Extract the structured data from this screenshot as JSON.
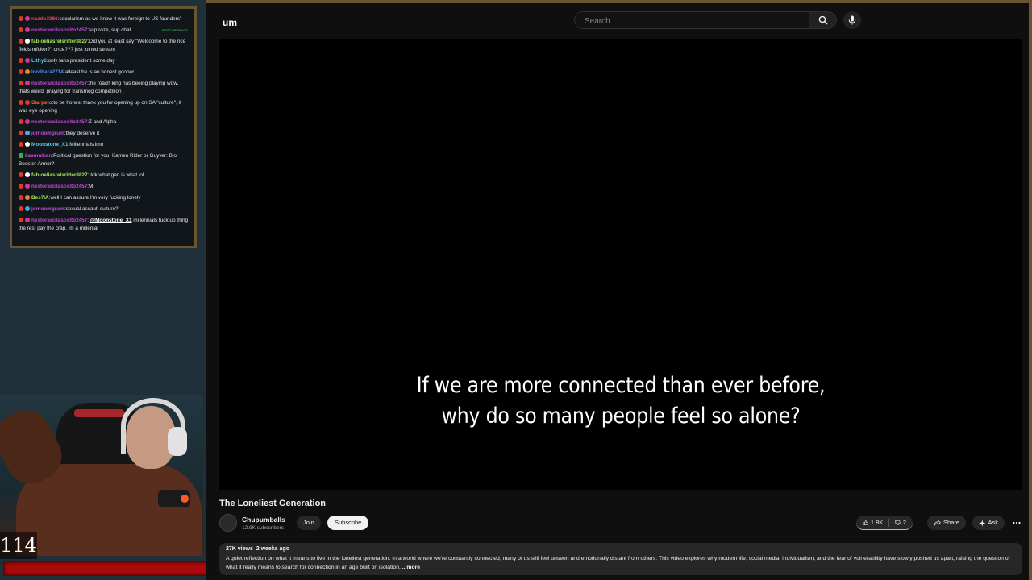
{
  "chat": {
    "messages": [
      {
        "user": "nazdo3366",
        "text": ":secularism as we know it was foreign to US founders'",
        "color": "u-red",
        "badges": [
          "b-red",
          "b-mag"
        ]
      },
      {
        "user": "nestorarcilasosito2457",
        "text": ":sup roze, sup chat",
        "color": "u-mag",
        "badges": [
          "b-red",
          "b-mag"
        ],
        "tag": "FIRST MESSAGE"
      },
      {
        "user": "fabioeliasreisritter8827",
        "text": ":Did you at least say \"Welcoome to the rice fields mfcker?\" once??? just joined stream",
        "color": "u-grn",
        "badges": [
          "b-red",
          "b-wht"
        ]
      },
      {
        "user": "Lithy6",
        "text": ":only fans president some day",
        "color": "u-cya",
        "badges": [
          "b-red",
          "b-mag"
        ]
      },
      {
        "user": "lordbara2714",
        "text": ":atleast he is an honest gooner",
        "color": "u-blu",
        "badges": [
          "b-red",
          "b-ora"
        ]
      },
      {
        "user": "nestorarcilasosito2457",
        "text": ":the roach king has beeing playing wow, thats weird, praying for transmog competition",
        "color": "u-mag",
        "badges": [
          "b-red",
          "b-mag"
        ]
      },
      {
        "user": "Slarpeto",
        "text": ":to be honest thank you for opening up on SA \"culture\", it was eye opening",
        "color": "u-ora",
        "badges": [
          "b-red",
          "b-red"
        ]
      },
      {
        "user": "nestorarcilasosito2457",
        "text": ":Z and Alpha",
        "color": "u-mag",
        "badges": [
          "b-red",
          "b-mag"
        ]
      },
      {
        "user": "jomoomgrum",
        "text": ":they deserve it",
        "color": "u-mag",
        "badges": [
          "b-red",
          "b-blu"
        ]
      },
      {
        "user": "Moonstone_X1",
        "text": ":Millennials imo",
        "color": "u-cya",
        "badges": [
          "b-red",
          "b-wht"
        ]
      },
      {
        "user": "kasumiban",
        "text": ":Political question for you. Kamen Rider or Guyver: Bio Booster Armor?",
        "color": "u-mag",
        "badges": [
          "b-grn"
        ]
      },
      {
        "user": "fabioeliasreisritter8827",
        "text": ": Idk what gen is what lol",
        "color": "u-grn",
        "badges": [
          "b-red",
          "b-wht"
        ]
      },
      {
        "user": "nestorarcilasosito2457",
        "text": ":M",
        "color": "u-mag",
        "badges": [
          "b-red",
          "b-mag"
        ]
      },
      {
        "user": "Bes7iA",
        "text": ":well I can assure I'm very fucking lonely",
        "color": "u-grn",
        "badges": [
          "b-red",
          "b-ora"
        ]
      },
      {
        "user": "jomoomgrum",
        "text": ":sexual assault culture?",
        "color": "u-mag",
        "badges": [
          "b-red",
          "b-blu"
        ]
      },
      {
        "user": "nestorarcilasosito2457",
        "text": " millennials fuck up thing the rest pay the crap, im a millenial",
        "mention": "@Moonstone_X1",
        "color": "u-mag",
        "badges": [
          "b-red",
          "b-mag"
        ]
      }
    ]
  },
  "overlay": {
    "viewer_count": "114",
    "health_bar_fill": 1.0
  },
  "youtube": {
    "logo_text": "um",
    "search_placeholder": "Search",
    "subtitle_line1": "If we are more connected than ever before,",
    "subtitle_line2": "why do so many people feel so alone?",
    "video_title": "The Loneliest Generation",
    "channel_name": "Chupumballs",
    "subscriber_count": "12.9K subscribers",
    "join_label": "Join",
    "subscribe_label": "Subscribe",
    "like_count": "1.8K",
    "dislike_count": "2",
    "share_label": "Share",
    "ask_label": "Ask",
    "views": "27K views",
    "posted": "2 weeks ago",
    "description": "A quiet reflection on what it means to live in the loneliest generation. In a world where we're constantly connected, many of us still feel unseen and emotionally distant from others. This video explores why modern life, social media, individualism, and the fear of vulnerability have slowly pushed us apart, raising the question of what it really means to search for connection in an age built on isolation.",
    "more_label": "...more"
  },
  "colors": {
    "frame_gold": "#6b5430",
    "health_red": "#ad0b0b",
    "yt_background": "#0f0f0f"
  }
}
